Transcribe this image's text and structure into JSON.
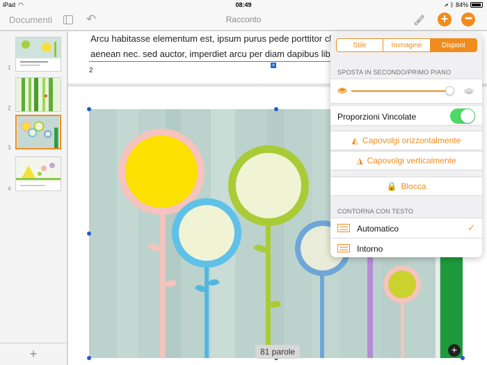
{
  "status": {
    "device": "iPad",
    "time": "08:49",
    "battery": "84%"
  },
  "navbar": {
    "documents": "Documenti",
    "title": "Racconto"
  },
  "thumbnails": [
    {
      "num": "1"
    },
    {
      "num": "2"
    },
    {
      "num": "3"
    },
    {
      "num": "4"
    }
  ],
  "thumb1_text": "Passeggiata primaverile di Ottavio",
  "document": {
    "text": "Arcu habitasse elementum est, ipsum purus pede porttitor class, ut adipiscing, aenean nec. sed auctor, imperdiet arcu per diam dapibus libero duis. Enim",
    "page_number": "2",
    "word_count": "81 parole"
  },
  "popover": {
    "tabs": [
      "Stile",
      "Immagine",
      "Disponi"
    ],
    "selected_tab": "Disponi",
    "arrange_header": "SPOSTA IN SECONDO/PRIMO PIANO",
    "slider_value": 0.95,
    "proportions_label": "Proporzioni Vincolate",
    "proportions_on": true,
    "flip_h": "Capovolgi orizzontalmente",
    "flip_v": "Capovolgi verticalmente",
    "lock": "Blocca",
    "wrap_header": "CONTORNA CON TESTO",
    "wrap_auto": "Automatico",
    "wrap_around": "Intorno"
  },
  "colors": {
    "accent": "#f08c1e",
    "toggle_on": "#4cd964",
    "selection": "#1e5fcf"
  }
}
